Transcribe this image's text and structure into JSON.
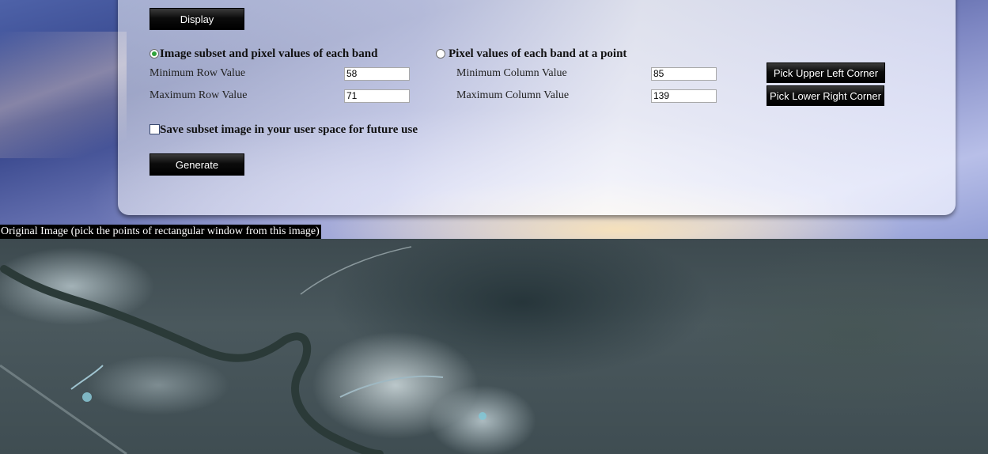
{
  "buttons": {
    "display": "Display",
    "generate": "Generate",
    "pick_upper_left": "Pick Upper Left Corner",
    "pick_lower_right": "Pick Lower Right Corner"
  },
  "mode": {
    "subset_label": "Image subset and pixel values of each band",
    "point_label": "Pixel values of each band at a point",
    "selected": "subset"
  },
  "fields": {
    "min_row": {
      "label": "Minimum Row Value",
      "value": "58"
    },
    "max_row": {
      "label": "Maximum Row Value",
      "value": "71"
    },
    "min_col": {
      "label": "Minimum Column Value",
      "value": "85"
    },
    "max_col": {
      "label": "Maximum Column Value",
      "value": "139"
    }
  },
  "save_subset": {
    "label": "Save subset image in your user space for future use",
    "checked": false
  },
  "original_image": {
    "caption": "Original Image (pick the points of rectangular window from this image)"
  },
  "colors": {
    "button_bg": "#000000",
    "radio_selected": "#2fa33a",
    "caption_bg": "#000000"
  }
}
